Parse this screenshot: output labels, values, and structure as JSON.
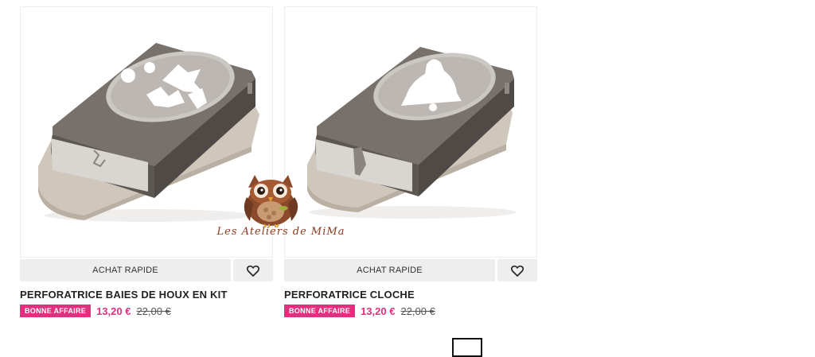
{
  "products": [
    {
      "title": "PERFORATRICE BAIES DE HOUX EN KIT",
      "quick_buy_label": "ACHAT RAPIDE",
      "badge": "BONNE AFFAIRE",
      "price": "13,20 €",
      "old_price": "22,00 €",
      "image": "holly-berries-punch-image",
      "wishlist_icon": "heart-icon"
    },
    {
      "title": "PERFORATRICE CLOCHE",
      "quick_buy_label": "ACHAT RAPIDE",
      "badge": "BONNE AFFAIRE",
      "price": "13,20 €",
      "old_price": "22,00 €",
      "image": "bell-punch-image",
      "wishlist_icon": "heart-icon"
    }
  ],
  "watermark": {
    "text": "Les Ateliers de MiMa",
    "image": "owl-logo"
  },
  "colors": {
    "accent": "#e0307e",
    "button_bg": "#eeeeee",
    "punch_body": "#6e6862",
    "punch_base": "#cfc7bb"
  }
}
